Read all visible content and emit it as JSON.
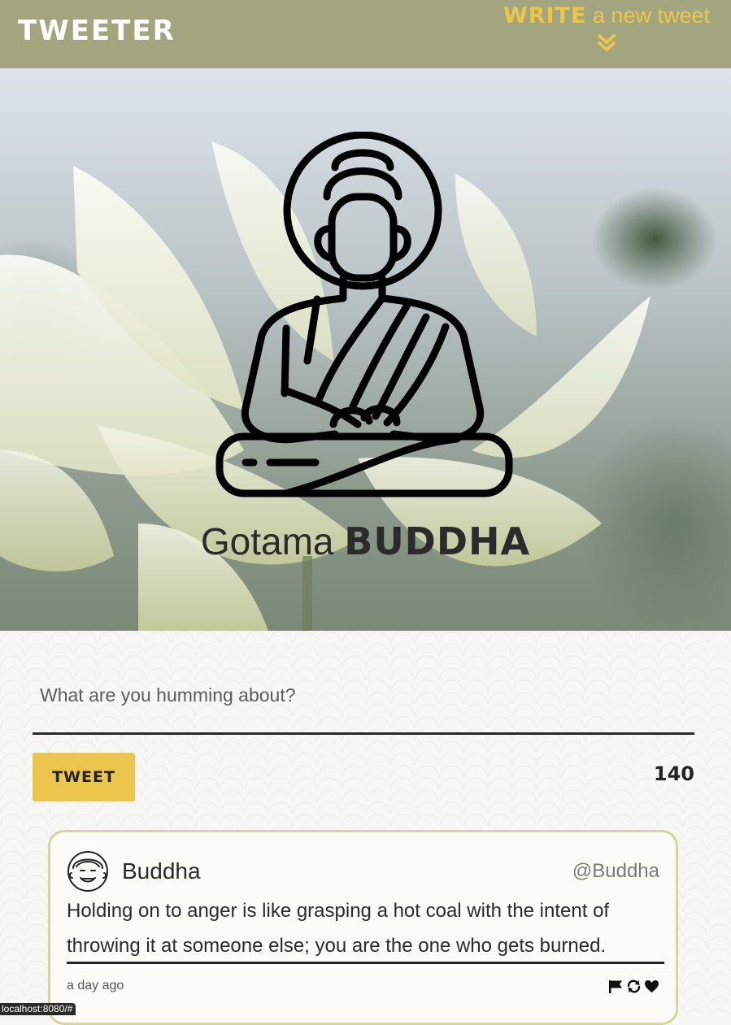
{
  "nav": {
    "brand": "TWEETER",
    "compose_emphasis": "WRITE",
    "compose_rest": "a new tweet",
    "compose_icon": "double-chevron-down-icon"
  },
  "profile": {
    "first_name": "Gotama",
    "last_name": "BUDDHA",
    "avatar_icon": "buddha-icon"
  },
  "composer": {
    "placeholder": "What are you humming about?",
    "value": "",
    "submit_label": "TWEET",
    "char_count": "140"
  },
  "tweets": [
    {
      "author": "Buddha",
      "handle": "@Buddha",
      "text": "Holding on to anger is like grasping a hot coal with the intent of throwing it at someone else; you are the one who gets burned.",
      "time": "a day ago",
      "actions": [
        "flag-icon",
        "retweet-icon",
        "heart-icon"
      ]
    }
  ],
  "status_bar": {
    "url": "localhost:8080/#"
  },
  "colors": {
    "nav_bg": "#a2a57d",
    "accent": "#ecc54c",
    "card_border": "#d4d799"
  }
}
